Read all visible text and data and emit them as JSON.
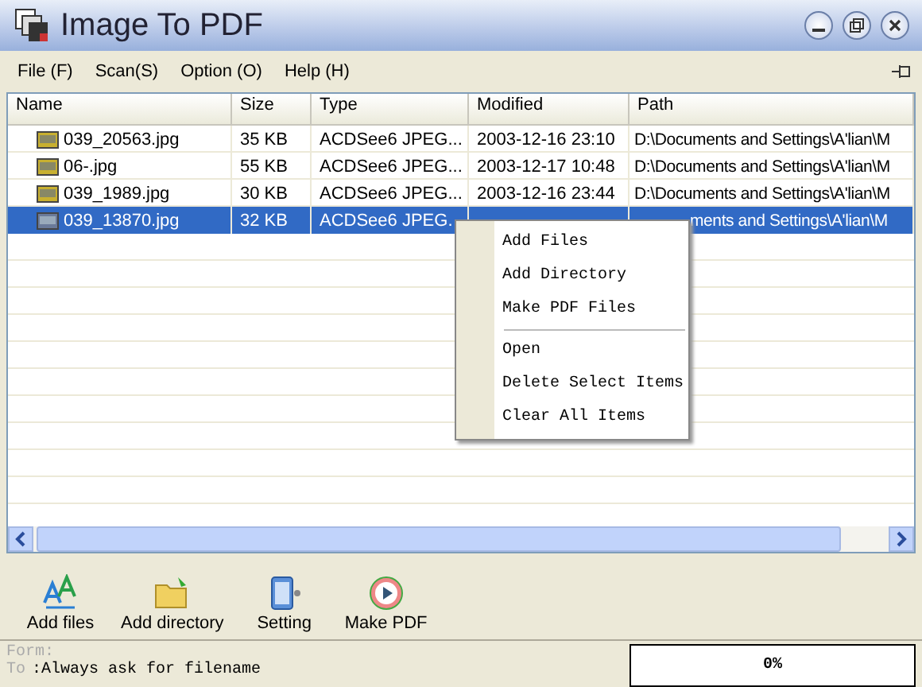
{
  "window": {
    "title": "Image To PDF"
  },
  "menu_bar": [
    "File (F)",
    "Scan(S)",
    "Option (O)",
    "Help (H)"
  ],
  "table": {
    "columns": [
      "Name",
      "Size",
      "Type",
      "Modified",
      "Path"
    ],
    "rows": [
      {
        "name": "039_20563.jpg",
        "size": "35 KB",
        "type": "ACDSee6 JPEG...",
        "modified": "2003-12-16 23:10",
        "path": "D:\\Documents and Settings\\A'lian\\M",
        "selected": false,
        "covered": false
      },
      {
        "name": "06-.jpg",
        "size": "55 KB",
        "type": "ACDSee6 JPEG...",
        "modified": "2003-12-17 10:48",
        "path": "D:\\Documents and Settings\\A'lian\\M",
        "selected": false,
        "covered": false
      },
      {
        "name": "039_1989.jpg",
        "size": "30 KB",
        "type": "ACDSee6 JPEG...",
        "modified": "2003-12-16 23:44",
        "path": "D:\\Documents and Settings\\A'lian\\M",
        "selected": false,
        "covered": false
      },
      {
        "name": "039_13870.jpg",
        "size": "32 KB",
        "type": "ACDSee6 JPEG.",
        "modified": "",
        "path": "ments and Settings\\A'lian\\M",
        "selected": true,
        "covered": true
      }
    ]
  },
  "context_menu": [
    {
      "label": "Add Files",
      "kind": "item"
    },
    {
      "label": "Add Directory",
      "kind": "item"
    },
    {
      "label": "Make PDF Files",
      "kind": "item"
    },
    {
      "kind": "separator"
    },
    {
      "label": "Open",
      "kind": "item"
    },
    {
      "label": "Delete Select Items",
      "kind": "item"
    },
    {
      "label": "Clear All Items",
      "kind": "item"
    }
  ],
  "toolbar": [
    {
      "label": "Add files",
      "kind": "files"
    },
    {
      "label": "Add directory",
      "kind": "folder"
    },
    {
      "label": "Setting",
      "kind": "setting"
    },
    {
      "label": "Make PDF",
      "kind": "play"
    }
  ],
  "status": {
    "form_label": "Form:",
    "to_label": "To",
    "to_value": ":Always ask for filename",
    "progress": {
      "text": "0%",
      "level": 0
    }
  }
}
